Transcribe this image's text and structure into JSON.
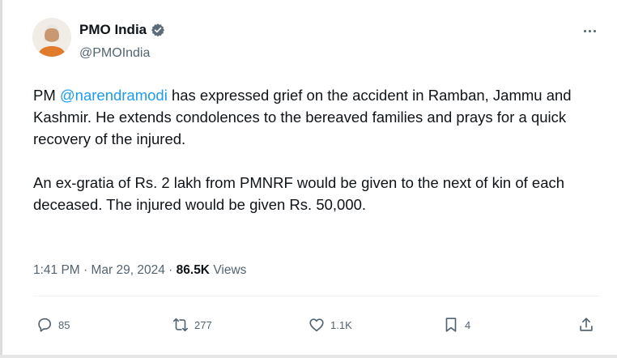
{
  "author": {
    "display_name": "PMO India",
    "handle": "@PMOIndia",
    "verified": true,
    "avatar_icon": "avatar-portrait"
  },
  "tweet": {
    "prefix": "PM ",
    "mention": "@narendramodi",
    "line1_rest": " has expressed grief on the accident in Ramban, Jammu and Kashmir. He extends condolences to the bereaved families and prays for a quick recovery of the injured.",
    "paragraph2": "An ex-gratia of Rs. 2 lakh from PMNRF would be given to the next of kin of each deceased. The injured would be given Rs. 50,000."
  },
  "meta": {
    "time": "1:41 PM",
    "separator": " · ",
    "date": "Mar 29, 2024",
    "views_count": "86.5K",
    "views_label": " Views"
  },
  "actions": {
    "replies": "85",
    "reposts": "277",
    "likes": "1.1K",
    "bookmarks": "4"
  },
  "colors": {
    "accent": "#1d9bf0",
    "text": "#0f1419",
    "secondary": "#536471"
  }
}
